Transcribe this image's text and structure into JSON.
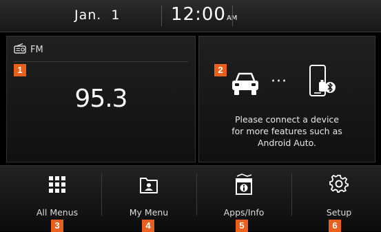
{
  "status": {
    "month": "Jan.",
    "day": "1",
    "time": "12:00",
    "ampm": "AM"
  },
  "radio": {
    "band": "FM",
    "frequency": "95.3",
    "icon": "radio-icon"
  },
  "phone": {
    "message_lines": [
      "Please connect a device",
      "for more features such as",
      "Android Auto."
    ],
    "icons": [
      "car-icon",
      "ellipsis-icon",
      "phone-bluetooth-icon"
    ]
  },
  "callouts": [
    "1",
    "2",
    "3",
    "4",
    "5",
    "6"
  ],
  "menu": {
    "items": [
      {
        "label": "All Menus",
        "icon": "grid-icon"
      },
      {
        "label": "My Menu",
        "icon": "my-menu-icon"
      },
      {
        "label": "Apps/Info",
        "icon": "apps-info-icon"
      },
      {
        "label": "Setup",
        "icon": "gear-icon"
      }
    ]
  },
  "colors": {
    "callout": "#e8601c",
    "background": "#000000",
    "text": "#ffffff"
  }
}
